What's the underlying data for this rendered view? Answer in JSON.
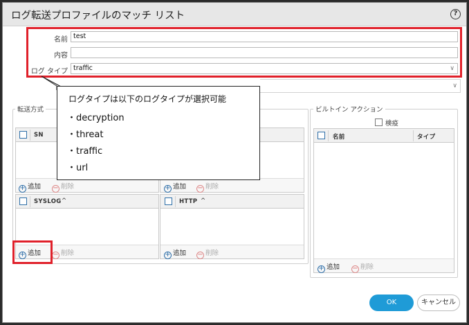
{
  "dialog": {
    "title": "ログ転送プロファイルのマッチ リスト",
    "help_icon": "?"
  },
  "form": {
    "name_label": "名前",
    "name_value": "test",
    "description_label": "内容",
    "description_value": "",
    "log_type_label": "ログ タイプ",
    "log_type_value": "traffic"
  },
  "forward_section": {
    "title": "転送方式",
    "grids": [
      {
        "header": "SN",
        "add_label": "追加",
        "delete_label": "削除"
      },
      {
        "header": "",
        "add_label": "追加",
        "delete_label": "削除"
      },
      {
        "header": "SYSLOG",
        "sort_icon": "^",
        "add_label": "追加",
        "delete_label": "削除"
      },
      {
        "header": "HTTP",
        "sort_icon": "^",
        "add_label": "追加",
        "delete_label": "削除"
      }
    ]
  },
  "builtin_section": {
    "title": "ビルトイン アクション",
    "filter_label": "検疫",
    "col_name": "名前",
    "col_type": "タイプ",
    "add_label": "追加",
    "delete_label": "削除"
  },
  "callout": {
    "title": "ログタイプは以下のログタイプが選択可能",
    "items": [
      "・decryption",
      "・threat",
      "・traffic",
      "・url"
    ]
  },
  "footer": {
    "ok_label": "OK",
    "cancel_label": "キャンセル"
  },
  "colors": {
    "highlight": "#e0202a",
    "accent": "#1f9bd7"
  }
}
